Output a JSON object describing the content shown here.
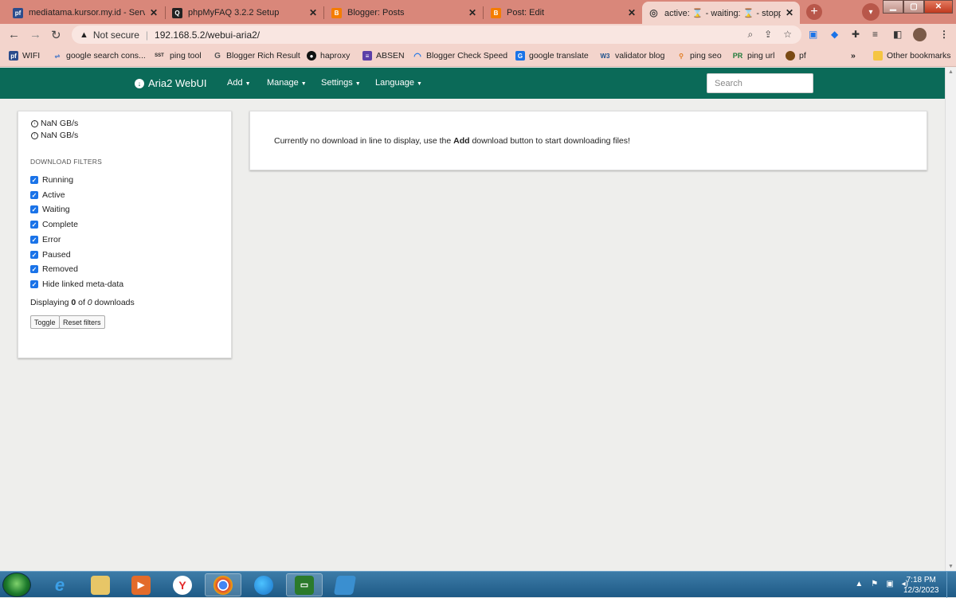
{
  "tabs": [
    {
      "title": "mediatama.kursor.my.id - Service",
      "icon": "pf-icon"
    },
    {
      "title": "phpMyFAQ 3.2.2 Setup",
      "icon": "phpmyfaq-icon"
    },
    {
      "title": "Blogger: Posts",
      "icon": "blogger-icon"
    },
    {
      "title": "Post: Edit",
      "icon": "blogger-icon"
    },
    {
      "title": "active: ⌛ - waiting: ⌛ - stopped: ⌛",
      "icon": "globe-icon"
    }
  ],
  "browser": {
    "not_secure": "Not secure",
    "url": "192.168.5.2/webui-aria2/"
  },
  "bookmarks": [
    {
      "label": "WIFI",
      "icon": "pf-icon"
    },
    {
      "label": "google search cons...",
      "icon": "search-console-icon"
    },
    {
      "label": "ping tool",
      "icon": "sst-icon"
    },
    {
      "label": "Blogger Rich Result",
      "icon": "google-icon"
    },
    {
      "label": "haproxy",
      "icon": "github-icon"
    },
    {
      "label": "ABSEN",
      "icon": "list-icon"
    },
    {
      "label": "Blogger Check Speed",
      "icon": "speed-icon"
    },
    {
      "label": "google translate",
      "icon": "translate-icon"
    },
    {
      "label": "validator blog",
      "icon": "w3-icon"
    },
    {
      "label": "ping seo",
      "icon": "ping-icon"
    },
    {
      "label": "ping url",
      "icon": "pr-icon"
    },
    {
      "label": "pf",
      "icon": "pf-circle-icon"
    }
  ],
  "other_bookmarks": "Other bookmarks",
  "more_bookmarks": "»",
  "app": {
    "brand": "Aria2 WebUI",
    "menu": {
      "add": "Add",
      "manage": "Manage",
      "settings": "Settings",
      "language": "Language"
    },
    "search_placeholder": "Search",
    "speed_down": "NaN GB/s",
    "speed_up": "NaN GB/s",
    "filters_title": "DOWNLOAD FILTERS",
    "filters": [
      {
        "label": "Running",
        "checked": true
      },
      {
        "label": "Active",
        "checked": true
      },
      {
        "label": "Waiting",
        "checked": true
      },
      {
        "label": "Complete",
        "checked": true
      },
      {
        "label": "Error",
        "checked": true
      },
      {
        "label": "Paused",
        "checked": true
      },
      {
        "label": "Removed",
        "checked": true
      },
      {
        "label": "Hide linked meta-data",
        "checked": true
      }
    ],
    "displaying": {
      "prefix": "Displaying ",
      "shown": "0",
      "mid": " of ",
      "total": "0",
      "suffix": " downloads"
    },
    "toggle": "Toggle",
    "reset": "Reset filters",
    "message": {
      "before": "Currently no download in line to display, use the ",
      "bold": "Add",
      "after": " download button to start downloading files!"
    }
  },
  "taskbar": {
    "time": "7:18 PM",
    "date": "12/3/2023"
  },
  "colors": {
    "navbar": "#0b6a58",
    "tabstrip": "#d9877a",
    "toolbar": "#f3d4cc"
  }
}
